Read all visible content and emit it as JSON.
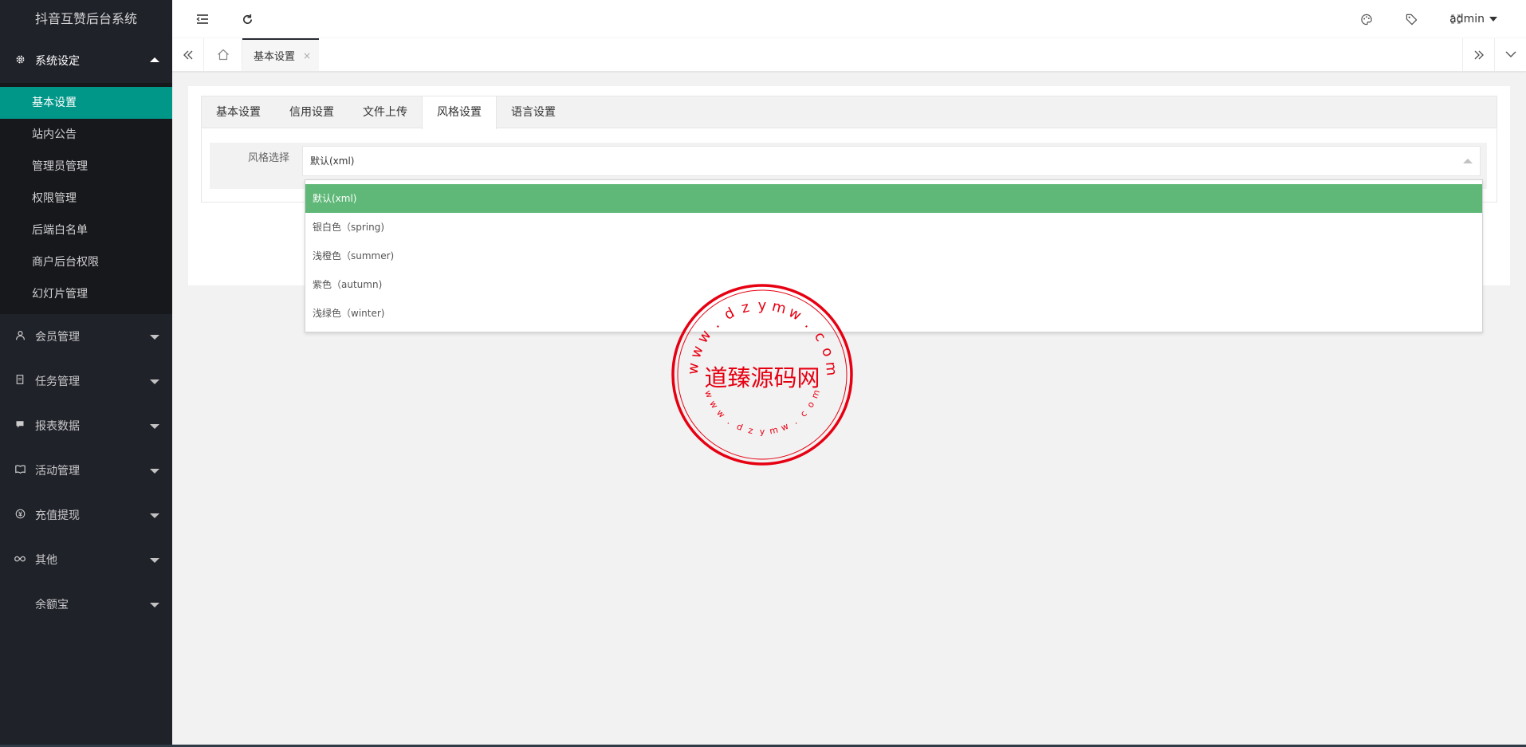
{
  "app": {
    "title": "抖音互赞后台系统"
  },
  "sidebar": {
    "groups": [
      {
        "label": "系统设定",
        "icon": "gear-icon",
        "open": true,
        "items": [
          {
            "label": "基本设置",
            "active": true
          },
          {
            "label": "站内公告"
          },
          {
            "label": "管理员管理"
          },
          {
            "label": "权限管理"
          },
          {
            "label": "后端白名单"
          },
          {
            "label": "商户后台权限"
          },
          {
            "label": "幻灯片管理"
          }
        ]
      },
      {
        "label": "会员管理",
        "icon": "user-icon"
      },
      {
        "label": "任务管理",
        "icon": "document-icon"
      },
      {
        "label": "报表数据",
        "icon": "chat-icon"
      },
      {
        "label": "活动管理",
        "icon": "book-icon"
      },
      {
        "label": "充值提现",
        "icon": "yen-icon"
      },
      {
        "label": "其他",
        "icon": "infinity-icon"
      },
      {
        "label": "余额宝",
        "icon": ""
      }
    ]
  },
  "header": {
    "user": "admin"
  },
  "tabsbar": {
    "active_tab": "基本设置",
    "close": "×"
  },
  "settings": {
    "tabs": [
      "基本设置",
      "信用设置",
      "文件上传",
      "风格设置",
      "语言设置"
    ],
    "active_tab_index": 3,
    "field_label": "风格选择",
    "selected_value": "默认(xml)",
    "options": [
      "默认(xml)",
      "银白色（spring)",
      "浅橙色（summer)",
      "紫色（autumn)",
      "浅绿色（winter)"
    ]
  },
  "watermark": {
    "center_text": "道臻源码网",
    "ring_text": "www.dzymw.com",
    "color": "#e60012"
  },
  "colors": {
    "sidebar_bg": "#20222a",
    "active_item": "#009688",
    "selected_option": "#5fb878"
  }
}
